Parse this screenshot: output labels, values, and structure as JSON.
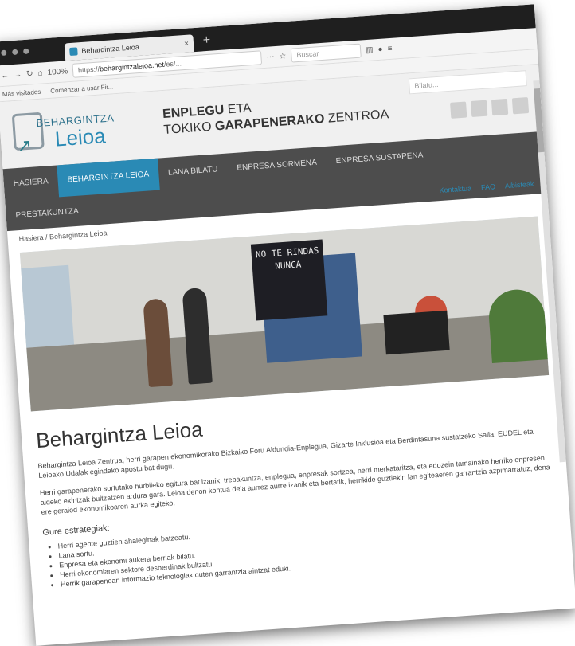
{
  "browser": {
    "tab_title": "Behargintza Leioa",
    "tab_close": "×",
    "new_tab": "+",
    "zoom": "100%",
    "url_prefix": "https://",
    "url_host": "behargintzaleioa.net",
    "url_rest": "/es/...",
    "search_placeholder": "Buscar",
    "bookmarks": [
      "Más visitados",
      "Comenzar a usar Fir..."
    ]
  },
  "site": {
    "logo_small": "BEHARGINTZA",
    "logo_big": "Leioa",
    "title_line1_bold": "ENPLEGU",
    "title_line1_rest": " ETA",
    "title_line2_pre": "TOKIKO ",
    "title_line2_bold": "GARAPENERAKO",
    "title_line2_post": " ZENTROA",
    "search_placeholder": "Bilatu...",
    "nav": [
      "HASIERA",
      "BEHARGINTZA LEIOA",
      "LANA BILATU",
      "ENPRESA SORMENA",
      "ENPRESA SUSTAPENA"
    ],
    "nav_row2": "PRESTAKUNTZA",
    "top_links": [
      "Kontaktua",
      "FAQ",
      "Albisteak"
    ],
    "breadcrumb": "Hasiera / Behargintza Leioa",
    "hero_poster": "NO TE RINDAS NUNCA"
  },
  "content": {
    "heading": "Behargintza Leioa",
    "p1": "Behargintza Leioa Zentrua, herri garapen ekonomikorako Bizkaiko Foru Aldundia-Enplegua, Gizarte Inklusioa eta Berdintasuna sustatzeko Saila, EUDEL eta Leioako Udalak egindako apostu bat dugu.",
    "p2": "Herri garapenerako sortutako hurbileko egitura bat izanik, trebakuntza, enplegua, enpresak sortzea, herri merkataritza, eta edozein tamainako herriko enpresen aldeko ekintzak bultzatzen ardura gara. Leioa denon kontua dela aurrez aurre izanik eta bertatik, herrikide guztiekin lan egiteaeren garrantzia azpimarratuz, dena ere geraiod ekonomikoaren aurka egiteko.",
    "strategies_title": "Gure estrategiak:",
    "strategies": [
      "Herri agente guztien ahaleginak batzeatu.",
      "Lana sortu.",
      "Enpresa eta ekonomi aukera berriak bilatu.",
      "Herri ekonomiaren sektore desberdinak bultzatu.",
      "Herrik garapenean informazio teknologiak duten garrantzia aintzat eduki."
    ]
  }
}
